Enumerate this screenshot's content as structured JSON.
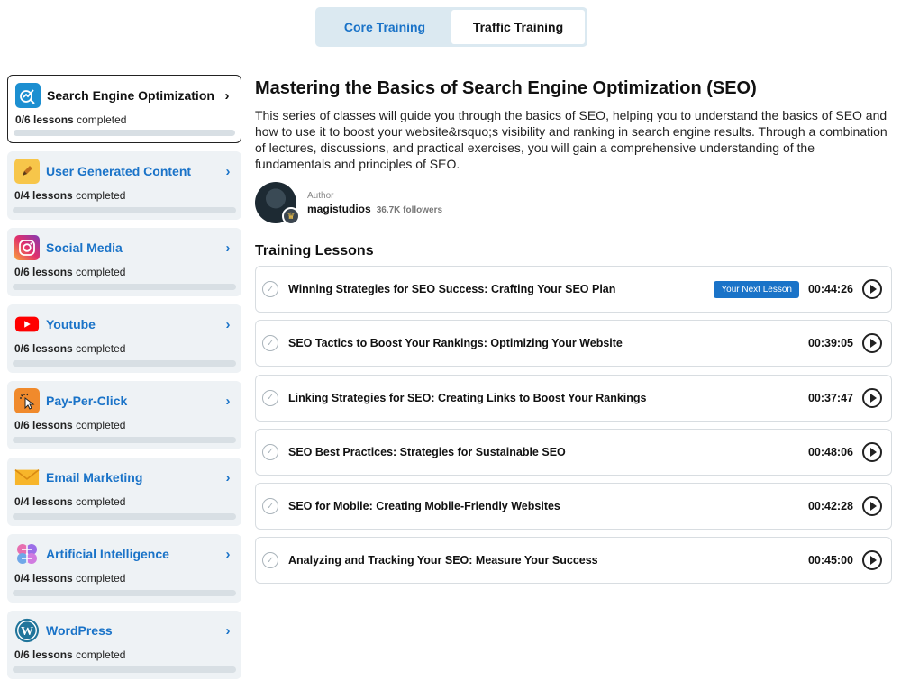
{
  "tabs": [
    {
      "label": "Core Training",
      "active": true
    },
    {
      "label": "Traffic Training",
      "active": false
    }
  ],
  "courses": [
    {
      "title": "Search Engine Optimization",
      "done": "0/6 lessons",
      "suffix": "completed",
      "icon": "seo-chart-icon",
      "progress": 0,
      "selected": true
    },
    {
      "title": "User Generated Content",
      "done": "0/4 lessons",
      "suffix": "completed",
      "icon": "pencil-icon",
      "progress": 0
    },
    {
      "title": "Social Media",
      "done": "0/6 lessons",
      "suffix": "completed",
      "icon": "instagram-icon",
      "progress": 0
    },
    {
      "title": "Youtube",
      "done": "0/6 lessons",
      "suffix": "completed",
      "icon": "youtube-icon",
      "progress": 0
    },
    {
      "title": "Pay-Per-Click",
      "done": "0/6 lessons",
      "suffix": "completed",
      "icon": "click-cursor-icon",
      "progress": 0
    },
    {
      "title": "Email Marketing",
      "done": "0/4 lessons",
      "suffix": "completed",
      "icon": "envelope-icon",
      "progress": 0
    },
    {
      "title": "Artificial Intelligence",
      "done": "0/4 lessons",
      "suffix": "completed",
      "icon": "brain-icon",
      "progress": 0
    },
    {
      "title": "WordPress",
      "done": "0/6 lessons",
      "suffix": "completed",
      "icon": "wordpress-icon",
      "progress": 0
    }
  ],
  "main": {
    "title": "Mastering the Basics of Search Engine Optimization (SEO)",
    "description": "This series of classes will guide you through the basics of SEO, helping you to understand the basics of SEO and how to use it to boost your website&rsquo;s visibility and ranking in search engine results. Through a combination of lectures, discussions, and practical exercises, you will gain a comprehensive understanding of the fundamentals and principles of SEO.",
    "author_label": "Author",
    "author_name": "magistudios",
    "followers": "36.7K followers",
    "lessons_heading": "Training Lessons",
    "next_badge": "Your Next Lesson",
    "lessons": [
      {
        "title": "Winning Strategies for SEO Success: Crafting Your SEO Plan",
        "duration": "00:44:26",
        "next": true
      },
      {
        "title": "SEO Tactics to Boost Your Rankings: Optimizing Your Website",
        "duration": "00:39:05"
      },
      {
        "title": "Linking Strategies for SEO: Creating Links to Boost Your Rankings",
        "duration": "00:37:47"
      },
      {
        "title": "SEO Best Practices: Strategies for Sustainable SEO",
        "duration": "00:48:06"
      },
      {
        "title": "SEO for Mobile: Creating Mobile-Friendly Websites",
        "duration": "00:42:28"
      },
      {
        "title": "Analyzing and Tracking Your SEO: Measure Your Success",
        "duration": "00:45:00"
      }
    ]
  },
  "colors": {
    "accent": "#1a73c8",
    "card_bg": "#eef2f5"
  }
}
